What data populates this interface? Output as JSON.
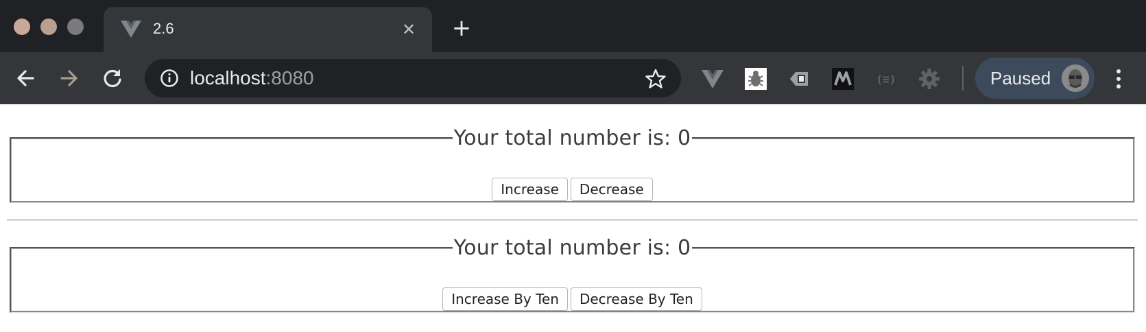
{
  "browser": {
    "window_controls": [
      {
        "name": "close",
        "color": "#c8a898"
      },
      {
        "name": "minimize",
        "color": "#b8a090"
      },
      {
        "name": "zoom",
        "color": "#7a7a7a"
      }
    ],
    "tab": {
      "title": "2.6",
      "favicon": "vue-logo-icon",
      "close_label": "✕"
    },
    "new_tab_label": "+",
    "address_bar": {
      "host": "localhost",
      "port": ":8080"
    },
    "extensions": [
      "vue-devtools-icon",
      "bug-icon",
      "tag-icon",
      "mark-icon",
      "braces-icon",
      "gear-icon"
    ],
    "profile": {
      "label": "Paused"
    },
    "colors": {
      "titlebar": "#202124",
      "toolbar": "#35363a",
      "profile_pill": "#3c4a5c"
    }
  },
  "page": {
    "counters": [
      {
        "legend": "Your total number is: 0",
        "buttons": [
          "Increase",
          "Decrease"
        ]
      },
      {
        "legend": "Your total number is: 0",
        "buttons": [
          "Increase By Ten",
          "Decrease By Ten"
        ]
      }
    ]
  }
}
